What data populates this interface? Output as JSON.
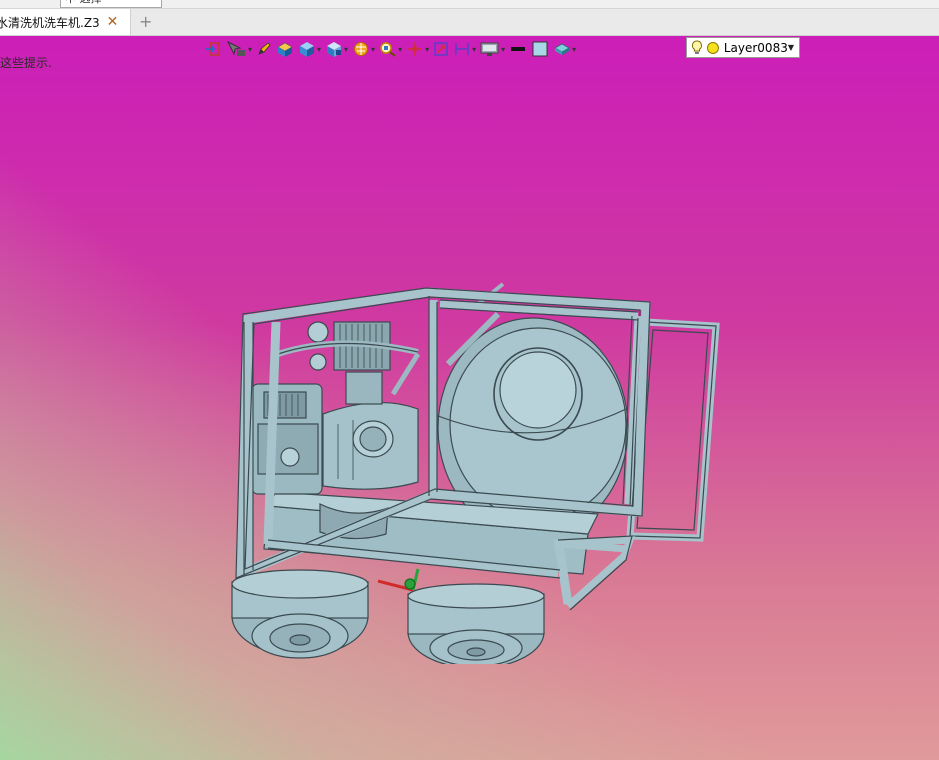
{
  "window": {
    "tab_title": "水清洗机洗车机.Z3",
    "tab_close": "✕",
    "tab_add": "+",
    "selection_combo": "中 选择"
  },
  "viewport": {
    "hint_text": "这些提示.",
    "background_colors": [
      "#cc1eb8",
      "#d97a95",
      "#a6d6a0"
    ]
  },
  "toolbar": {
    "items": [
      {
        "icon": "import-icon"
      },
      {
        "icon": "pointer-filter-icon"
      },
      {
        "icon": "pencil-icon"
      },
      {
        "icon": "view-box-icon"
      },
      {
        "icon": "shaded-cube-icon"
      },
      {
        "icon": "section-cube-icon"
      },
      {
        "icon": "render-mode-icon"
      },
      {
        "icon": "zoom-icon"
      },
      {
        "icon": "pan-icon"
      },
      {
        "icon": "rotate-icon"
      },
      {
        "icon": "measure-icon"
      },
      {
        "icon": "display-icon"
      },
      {
        "icon": "line-color-swatch",
        "color": "#111111"
      },
      {
        "icon": "fill-color-swatch",
        "color": "#a8d8e8"
      },
      {
        "icon": "part-icon"
      }
    ],
    "layer": {
      "name": "Layer0083",
      "bulb_color": "#f6e11b"
    }
  },
  "model": {
    "color": "#a7c4cc",
    "outline": "#3b4a50"
  }
}
